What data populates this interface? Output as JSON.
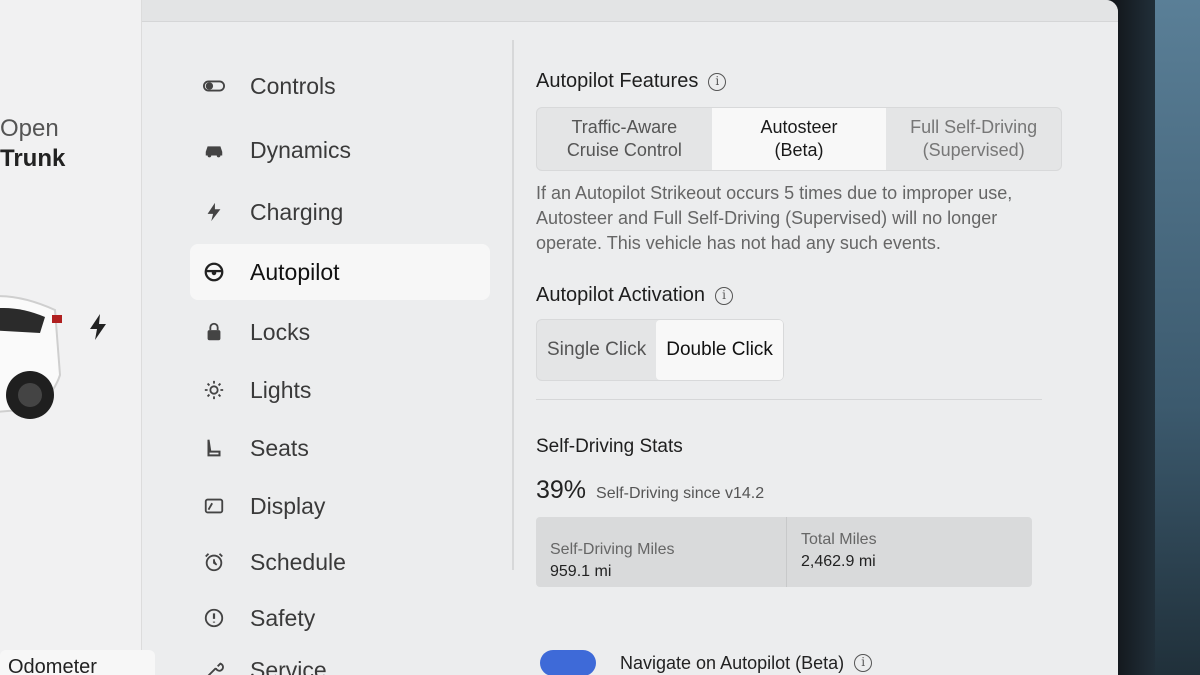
{
  "car_panel": {
    "trunk_line1": "Open",
    "trunk_line2": "Trunk",
    "odometer_label": "Odometer"
  },
  "nav": {
    "items": [
      {
        "label": "Controls",
        "icon": "toggle-icon"
      },
      {
        "label": "Dynamics",
        "icon": "car-icon"
      },
      {
        "label": "Charging",
        "icon": "bolt-icon"
      },
      {
        "label": "Autopilot",
        "icon": "steering-wheel-icon",
        "active": true
      },
      {
        "label": "Locks",
        "icon": "lock-icon"
      },
      {
        "label": "Lights",
        "icon": "light-icon"
      },
      {
        "label": "Seats",
        "icon": "seat-icon"
      },
      {
        "label": "Display",
        "icon": "display-icon"
      },
      {
        "label": "Schedule",
        "icon": "alarm-clock-icon"
      },
      {
        "label": "Safety",
        "icon": "alert-circle-icon"
      },
      {
        "label": "Service",
        "icon": "wrench-icon"
      }
    ]
  },
  "autopilot_features": {
    "title": "Autopilot Features",
    "options": [
      {
        "line1": "Traffic-Aware",
        "line2": "Cruise Control"
      },
      {
        "line1": "Autosteer",
        "line2": "(Beta)",
        "selected": true
      },
      {
        "line1": "Full Self-Driving",
        "line2": "(Supervised)"
      }
    ],
    "description": "If an Autopilot Strikeout occurs 5 times due to improper use, Autosteer and Full Self-Driving (Supervised) will no longer operate. This vehicle has not had any such events."
  },
  "autopilot_activation": {
    "title": "Autopilot Activation",
    "options": [
      {
        "label": "Single Click"
      },
      {
        "label": "Double Click",
        "selected": true
      }
    ]
  },
  "stats": {
    "title": "Self-Driving Stats",
    "percent": "39%",
    "percent_label": "Self-Driving since v14.2",
    "self_driving_miles_label": "Self-Driving Miles",
    "self_driving_miles_value": "959.1 mi",
    "total_miles_label": "Total Miles",
    "total_miles_value": "2,462.9 mi"
  },
  "navigate_on_autopilot": {
    "label": "Navigate on Autopilot (Beta)",
    "enabled": true
  },
  "colors": {
    "toggle_on": "#3e6ad8",
    "screen_bg": "#ecedee"
  }
}
